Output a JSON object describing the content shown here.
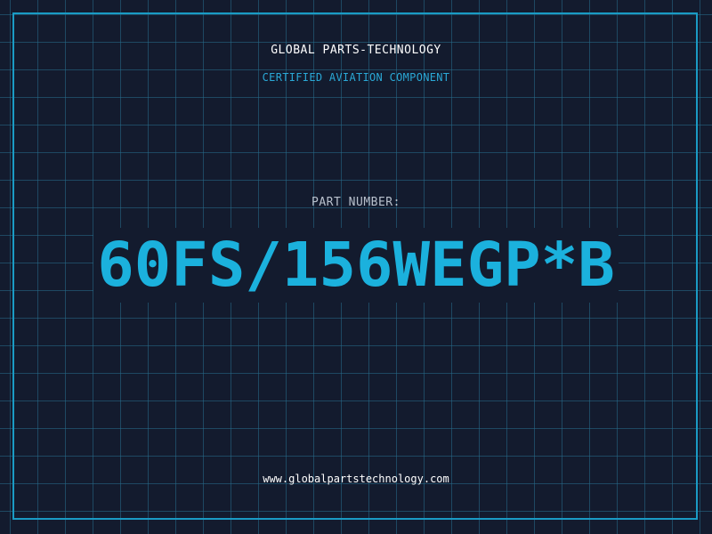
{
  "label": {
    "brand": "GLOBAL PARTS-TECHNOLOGY",
    "subtitle": "CERTIFIED AVIATION COMPONENT",
    "part_number_label": "PART NUMBER:",
    "part_number": "60FS/156WEGP*B",
    "website": "www.globalpartstechnology.com"
  },
  "colors": {
    "background": "#131b2e",
    "grid": "#266e8c",
    "frame": "#1a9bc4",
    "accent": "#1bb1dd",
    "text": "#ffffff",
    "muted": "#b8c0cc"
  }
}
